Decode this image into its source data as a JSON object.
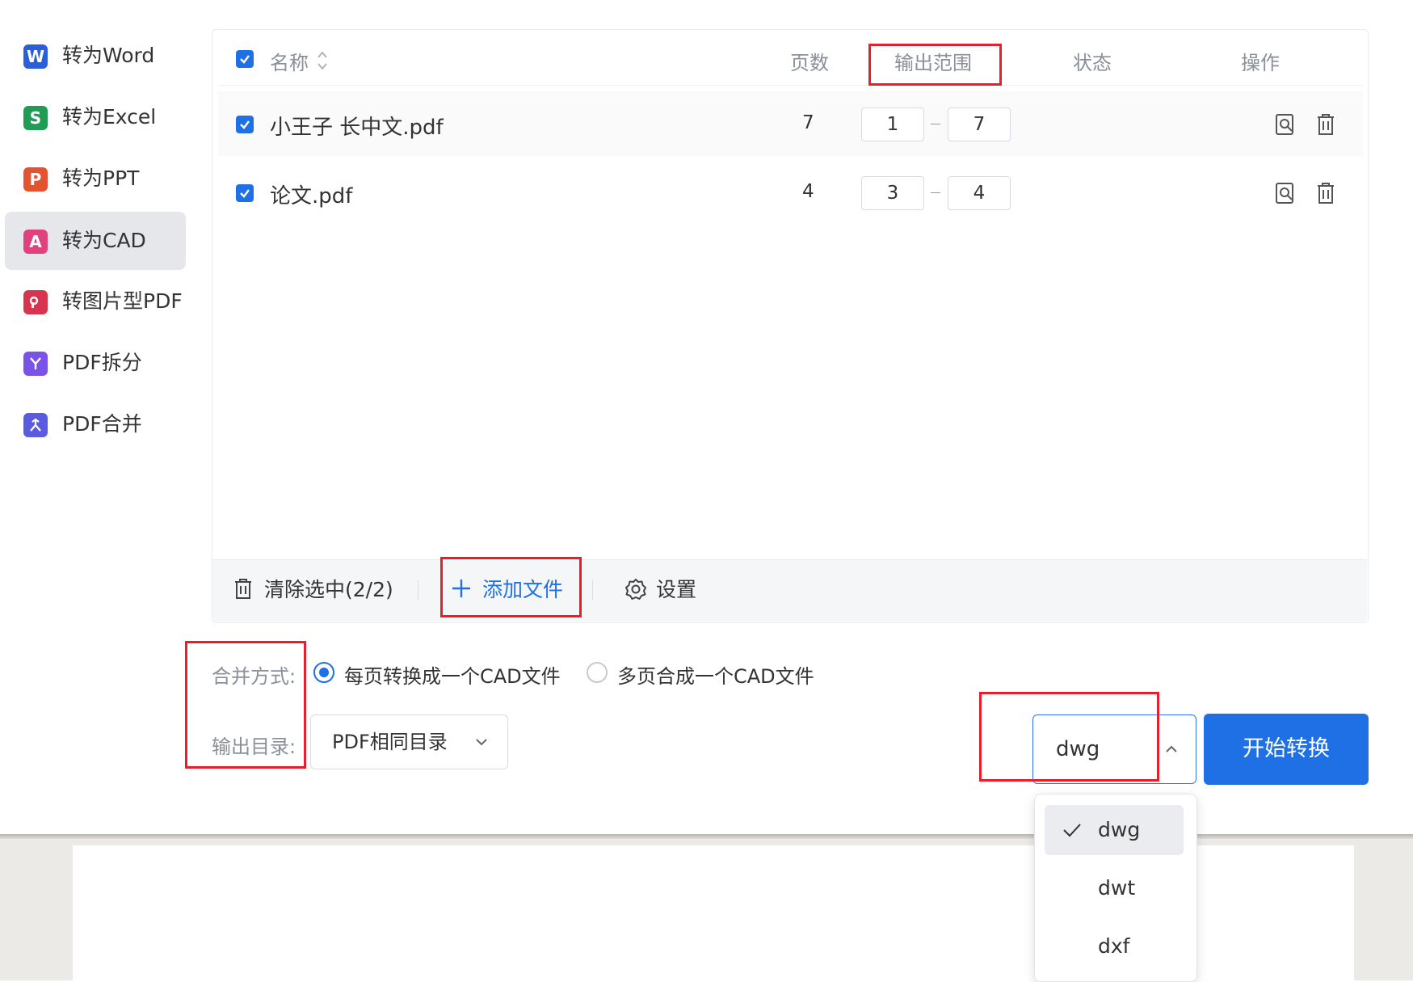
{
  "sidebar": {
    "items": [
      {
        "label": "转为Word",
        "icon": "W",
        "color": "#2b5fd9"
      },
      {
        "label": "转为Excel",
        "icon": "S",
        "color": "#1f9d55"
      },
      {
        "label": "转为PPT",
        "icon": "P",
        "color": "#e2532f"
      },
      {
        "label": "转为CAD",
        "icon": "A",
        "color": "#e0417f",
        "active": true
      },
      {
        "label": "转图片型PDF",
        "icon": "image-pdf-icon",
        "color": "#d9344f"
      },
      {
        "label": "PDF拆分",
        "icon": "split-icon",
        "color": "#7b52e8"
      },
      {
        "label": "PDF合并",
        "icon": "merge-icon",
        "color": "#5b5bdf"
      }
    ]
  },
  "table": {
    "headers": {
      "name": "名称",
      "pages": "页数",
      "range": "输出范围",
      "status": "状态",
      "actions": "操作"
    },
    "rows": [
      {
        "name": "小王子 长中文.pdf",
        "pages": "7",
        "from": "1",
        "to": "7",
        "status": ""
      },
      {
        "name": "论文.pdf",
        "pages": "4",
        "from": "3",
        "to": "4",
        "status": ""
      }
    ]
  },
  "toolbar": {
    "clear": "清除选中(2/2)",
    "add": "添加文件",
    "settings": "设置"
  },
  "options": {
    "merge_label": "合并方式:",
    "merge_option1": "每页转换成一个CAD文件",
    "merge_option2": "多页合成一个CAD文件",
    "output_label": "输出目录:",
    "output_value": "PDF相同目录"
  },
  "format": {
    "value": "dwg",
    "options": [
      "dwg",
      "dwt",
      "dxf"
    ]
  },
  "start_button": "开始转换",
  "colors": {
    "primary": "#1f6fe5",
    "highlight": "#e5202a"
  }
}
